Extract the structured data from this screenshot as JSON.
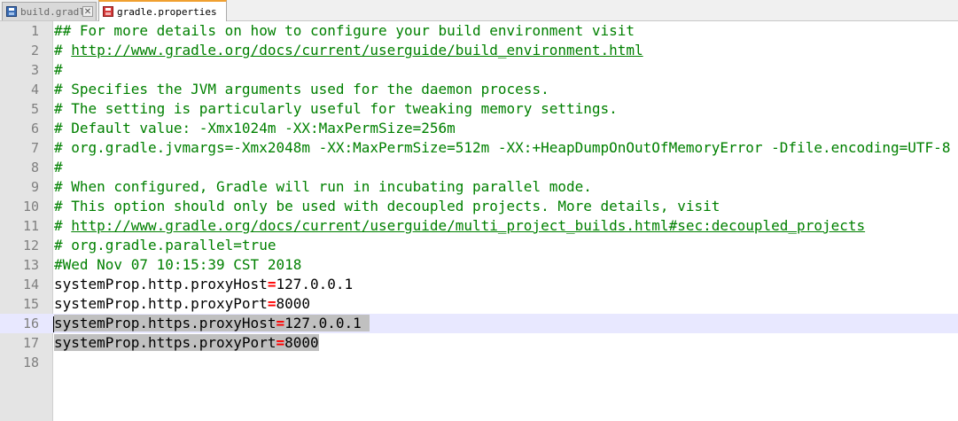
{
  "tabs": [
    {
      "label": "build.gradle",
      "icon": "save-icon",
      "active": false
    },
    {
      "label": "gradle.properties",
      "icon": "unsaved-icon",
      "active": true
    }
  ],
  "editor": {
    "lines": [
      {
        "num": "1",
        "kind": "comment",
        "text": "## For more details on how to configure your build environment visit"
      },
      {
        "num": "2",
        "kind": "comment-url",
        "prefix": "# ",
        "url": "http://www.gradle.org/docs/current/userguide/build_environment.html"
      },
      {
        "num": "3",
        "kind": "comment",
        "text": "#"
      },
      {
        "num": "4",
        "kind": "comment",
        "text": "# Specifies the JVM arguments used for the daemon process."
      },
      {
        "num": "5",
        "kind": "comment",
        "text": "# The setting is particularly useful for tweaking memory settings."
      },
      {
        "num": "6",
        "kind": "comment",
        "text": "# Default value: -Xmx1024m -XX:MaxPermSize=256m"
      },
      {
        "num": "7",
        "kind": "comment",
        "text": "# org.gradle.jvmargs=-Xmx2048m -XX:MaxPermSize=512m -XX:+HeapDumpOnOutOfMemoryError -Dfile.encoding=UTF-8"
      },
      {
        "num": "8",
        "kind": "comment",
        "text": "#"
      },
      {
        "num": "9",
        "kind": "comment",
        "text": "# When configured, Gradle will run in incubating parallel mode."
      },
      {
        "num": "10",
        "kind": "comment",
        "text": "# This option should only be used with decoupled projects. More details, visit"
      },
      {
        "num": "11",
        "kind": "comment-url",
        "prefix": "# ",
        "url": "http://www.gradle.org/docs/current/userguide/multi_project_builds.html#sec:decoupled_projects"
      },
      {
        "num": "12",
        "kind": "comment",
        "text": "# org.gradle.parallel=true"
      },
      {
        "num": "13",
        "kind": "comment",
        "text": "#Wed Nov 07 10:15:39 CST 2018"
      },
      {
        "num": "14",
        "kind": "property",
        "key": "systemProp.http.proxyHost",
        "value": "127.0.0.1"
      },
      {
        "num": "15",
        "kind": "property",
        "key": "systemProp.http.proxyPort",
        "value": "8000"
      },
      {
        "num": "16",
        "kind": "property",
        "key": "systemProp.https.proxyHost",
        "value": "127.0.0.1 ",
        "selected": true,
        "current": true,
        "caret": true
      },
      {
        "num": "17",
        "kind": "property",
        "key": "systemProp.https.proxyPort",
        "value": "8000",
        "selected": true
      },
      {
        "num": "18",
        "kind": "empty"
      }
    ]
  }
}
